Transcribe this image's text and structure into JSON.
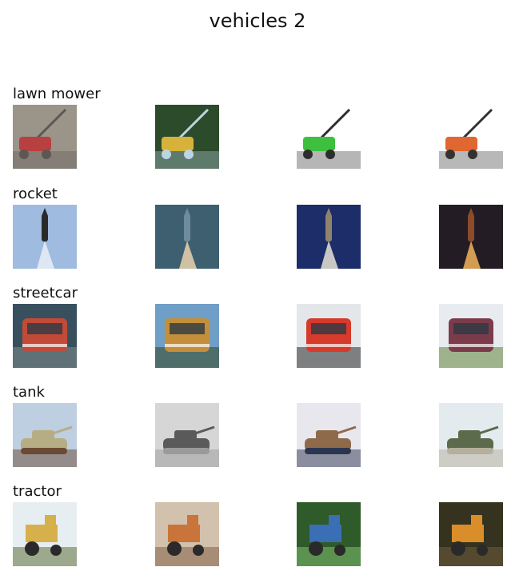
{
  "figure": {
    "title": "vehicles 2"
  },
  "rows": [
    {
      "label": "lawn mower",
      "images": [
        {
          "icon": "lawn-mower-photo",
          "colors": [
            "#9a9489",
            "#b84040",
            "#5c5752"
          ]
        },
        {
          "icon": "lawn-mower-photo",
          "colors": [
            "#2c4b2a",
            "#d7b23b",
            "#bcd4e4"
          ]
        },
        {
          "icon": "lawn-mower-photo",
          "colors": [
            "#ffffff",
            "#3fbf3f",
            "#2d2d2d"
          ]
        },
        {
          "icon": "lawn-mower-photo",
          "colors": [
            "#ffffff",
            "#e0672f",
            "#333333"
          ]
        }
      ]
    },
    {
      "label": "rocket",
      "images": [
        {
          "icon": "rocket-photo",
          "colors": [
            "#9fbce0",
            "#e9eef6",
            "#2a2a2a"
          ]
        },
        {
          "icon": "rocket-photo",
          "colors": [
            "#3d5f70",
            "#e7d2ad",
            "#6e8c9b"
          ]
        },
        {
          "icon": "rocket-photo",
          "colors": [
            "#1c2d6a",
            "#e7e3d3",
            "#90836c"
          ]
        },
        {
          "icon": "rocket-photo",
          "colors": [
            "#231c24",
            "#f1b35a",
            "#8c4b2a"
          ]
        }
      ]
    },
    {
      "label": "streetcar",
      "images": [
        {
          "icon": "streetcar-photo",
          "colors": [
            "#38505e",
            "#c24a39",
            "#7a8587"
          ]
        },
        {
          "icon": "streetcar-photo",
          "colors": [
            "#6f9ec6",
            "#c48f3a",
            "#3c4f2b"
          ]
        },
        {
          "icon": "streetcar-photo",
          "colors": [
            "#e3e7ea",
            "#d53a2a",
            "#3a3a3a"
          ]
        },
        {
          "icon": "streetcar-photo",
          "colors": [
            "#e8ecf1",
            "#7c3b4b",
            "#6c8d4a"
          ]
        }
      ]
    },
    {
      "label": "tank",
      "images": [
        {
          "icon": "tank-photo",
          "colors": [
            "#bdcfe0",
            "#b7ad84",
            "#6b4a33"
          ]
        },
        {
          "icon": "tank-photo",
          "colors": [
            "#d6d6d6",
            "#5a5a5a",
            "#9a9a9a"
          ]
        },
        {
          "icon": "tank-photo",
          "colors": [
            "#e9e7ee",
            "#8f6a4a",
            "#2c3550"
          ]
        },
        {
          "icon": "tank-photo",
          "colors": [
            "#e4ebef",
            "#5b6b4b",
            "#b5b09d"
          ]
        }
      ]
    },
    {
      "label": "tractor",
      "images": [
        {
          "icon": "tractor-photo",
          "colors": [
            "#e7eef1",
            "#d6b04a",
            "#6b7b4b"
          ]
        },
        {
          "icon": "tractor-photo",
          "colors": [
            "#d2c1ac",
            "#c9743a",
            "#8a6b52"
          ]
        },
        {
          "icon": "tractor-photo",
          "colors": [
            "#2f5a2a",
            "#3a6eb5",
            "#7cb86b"
          ]
        },
        {
          "icon": "tractor-photo",
          "colors": [
            "#35321f",
            "#d98e2a",
            "#6b5a3a"
          ]
        }
      ]
    }
  ]
}
